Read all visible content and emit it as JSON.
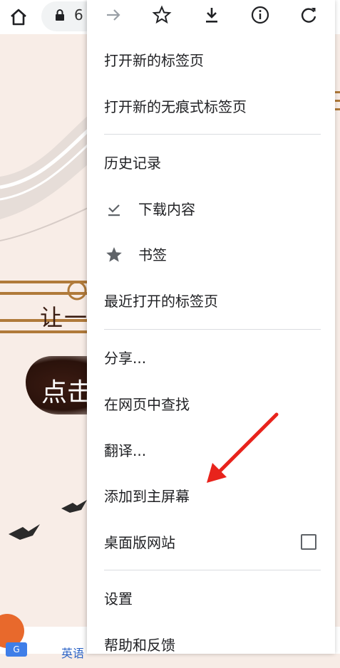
{
  "browser": {
    "url_fragment": "6",
    "icons": [
      "home-icon",
      "lock-icon"
    ]
  },
  "background": {
    "title_fragment": "让一",
    "button_fragment": "点击",
    "bottom_link_fragment": "英语",
    "bottom_badge": "G"
  },
  "menu": {
    "toolbar": [
      "forward-icon",
      "star-icon",
      "download-icon",
      "info-icon",
      "refresh-icon"
    ],
    "items": [
      {
        "label": "打开新的标签页"
      },
      {
        "label": "打开新的无痕式标签页"
      },
      {
        "label": "历史记录"
      },
      {
        "label": "下载内容",
        "icon": "download-check-icon"
      },
      {
        "label": "书签",
        "icon": "star-filled-icon"
      },
      {
        "label": "最近打开的标签页"
      },
      {
        "label": "分享..."
      },
      {
        "label": "在网页中查找"
      },
      {
        "label": "翻译..."
      },
      {
        "label": "添加到主屏幕"
      },
      {
        "label": "桌面版网站",
        "checked": false
      },
      {
        "label": "设置"
      },
      {
        "label": "帮助和反馈"
      }
    ]
  },
  "colors": {
    "menu_bg": "#ffffff",
    "text": "#202124",
    "icon": "#5f6368",
    "divider": "#dadce0",
    "annotation": "#e8231c"
  }
}
